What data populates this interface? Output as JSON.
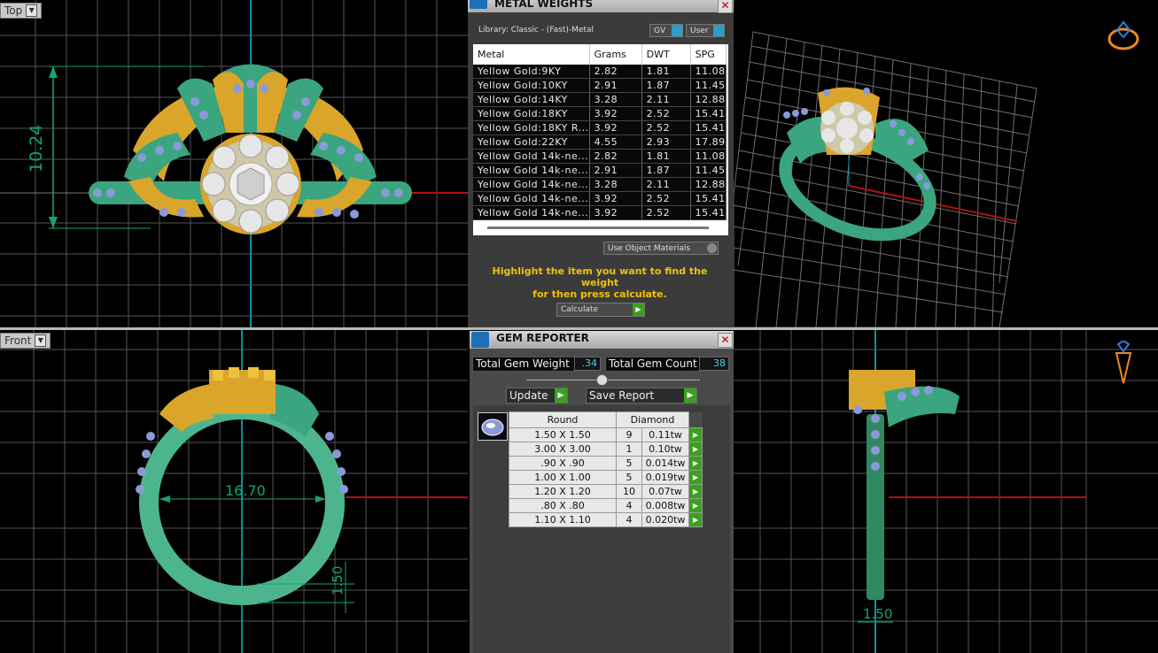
{
  "viewports": {
    "top_label": "Top",
    "front_label": "Front",
    "dims": {
      "top_height": "10.24",
      "front_inner": "16.70",
      "front_small": "1.50",
      "side_width": "1.50"
    }
  },
  "metal_weights": {
    "title": "METAL WEIGHTS",
    "library": "Library: Classic - (Fast)-Metal",
    "toggles": [
      "GV",
      "User"
    ],
    "columns": [
      "Metal",
      "Grams",
      "DWT",
      "SPG"
    ],
    "rows": [
      [
        "Yellow Gold:9KY",
        "2.82",
        "1.81",
        "11.08"
      ],
      [
        "Yellow Gold:10KY",
        "2.91",
        "1.87",
        "11.45"
      ],
      [
        "Yellow Gold:14KY",
        "3.28",
        "2.11",
        "12.88"
      ],
      [
        "Yellow Gold:18KY",
        "3.92",
        "2.52",
        "15.41"
      ],
      [
        "Yellow Gold:18KY R...",
        "3.92",
        "2.52",
        "15.41"
      ],
      [
        "Yellow Gold:22KY",
        "4.55",
        "2.93",
        "17.89"
      ],
      [
        "Yellow Gold 14k-ne...",
        "2.82",
        "1.81",
        "11.08"
      ],
      [
        "Yellow Gold 14k-ne...",
        "2.91",
        "1.87",
        "11.45"
      ],
      [
        "Yellow Gold 14k-ne...",
        "3.28",
        "2.11",
        "12.88"
      ],
      [
        "Yellow Gold 14k-ne...",
        "3.92",
        "2.52",
        "15.41"
      ],
      [
        "Yellow Gold 14k-ne...",
        "3.92",
        "2.52",
        "15.41"
      ]
    ],
    "use_object_materials": "Use Object Materials",
    "highlight_line1": "Highlight the item you want to find the weight",
    "highlight_line2": "for then press calculate.",
    "calculate": "Calculate"
  },
  "gem_reporter": {
    "title": "GEM REPORTER",
    "total_weight_label": "Total Gem Weight",
    "total_weight_value": ".34",
    "total_count_label": "Total Gem Count",
    "total_count_value": "38",
    "update": "Update",
    "save_report": "Save Report",
    "col_shape": "Round",
    "col_type": "Diamond",
    "rows": [
      [
        "1.50 X 1.50",
        "9",
        "0.11tw"
      ],
      [
        "3.00 X 3.00",
        "1",
        "0.10tw"
      ],
      [
        ".90 X .90",
        "5",
        "0.014tw"
      ],
      [
        "1.00 X 1.00",
        "5",
        "0.019tw"
      ],
      [
        "1.20 X 1.20",
        "10",
        "0.07tw"
      ],
      [
        ".80 X .80",
        "4",
        "0.008tw"
      ],
      [
        "1.10 X 1.10",
        "4",
        "0.020tw"
      ]
    ]
  },
  "colors": {
    "metal_green": "#3aa57f",
    "gold": "#d9a52a",
    "gem_blue": "#8a9ad8",
    "dim_green": "#13a37a"
  }
}
